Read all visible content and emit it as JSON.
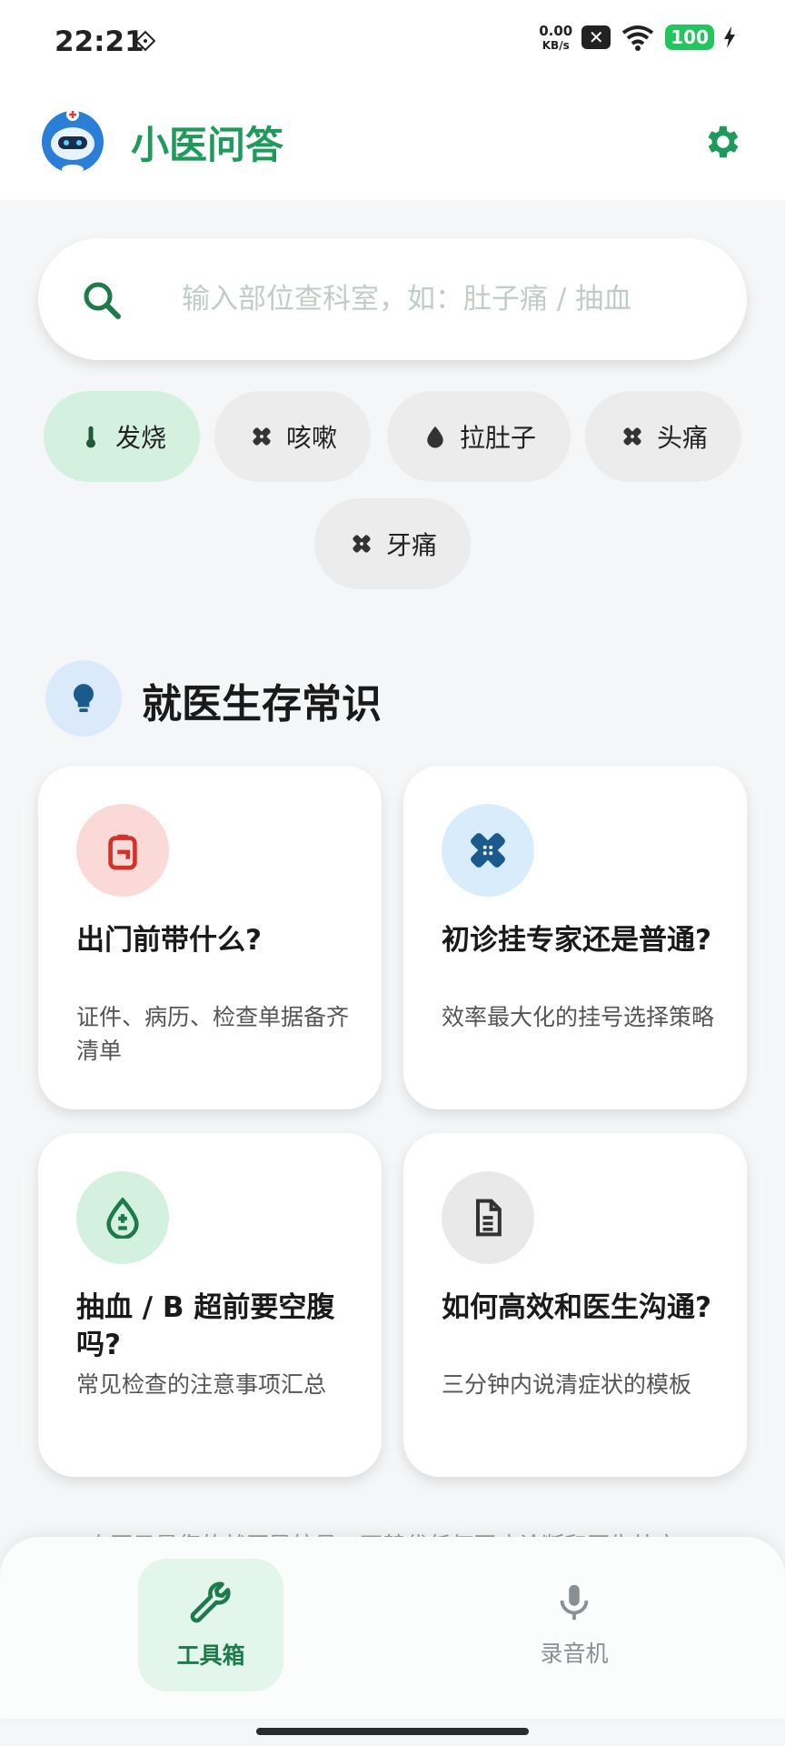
{
  "status": {
    "time": "22:21",
    "net_speed_value": "0.00",
    "net_speed_unit": "KB/s",
    "battery": "100"
  },
  "header": {
    "title": "小医问答",
    "logo_icon": "doctor-robot-avatar",
    "settings_icon": "gear-icon"
  },
  "search": {
    "placeholder": "输入部位查科室，如：肚子痛 / 抽血",
    "value": ""
  },
  "chips": [
    {
      "label": "发烧",
      "icon": "thermometer-icon",
      "active": true
    },
    {
      "label": "咳嗽",
      "icon": "bandage-icon",
      "active": false
    },
    {
      "label": "拉肚子",
      "icon": "water-drop-icon",
      "active": false
    },
    {
      "label": "头痛",
      "icon": "bandage-icon",
      "active": false
    },
    {
      "label": "牙痛",
      "icon": "bandage-icon",
      "active": false
    }
  ],
  "section": {
    "title": "就医生存常识",
    "icon": "lightbulb-icon"
  },
  "cards": [
    {
      "title": "出门前带什么?",
      "desc": "证件、病历、检查单据备齐清单",
      "icon": "backpack-icon",
      "icon_bg": "#fbd9d6",
      "icon_color": "#d0332b"
    },
    {
      "title": "初诊挂专家还是普通?",
      "desc": "效率最大化的挂号选择策略",
      "icon": "bandage-icon",
      "icon_bg": "#d9ecfb",
      "icon_color": "#1a5a8c"
    },
    {
      "title": "抽血 / B 超前要空腹吗?",
      "desc": "常见检查的注意事项汇总",
      "icon": "blood-drop-plus-minus-icon",
      "icon_bg": "#d4f1e0",
      "icon_color": "#1e7a4a"
    },
    {
      "title": "如何高效和医生沟通?",
      "desc": "三分钟内说清症状的模板",
      "icon": "document-icon",
      "icon_bg": "#e9e9e9",
      "icon_color": "#333333"
    }
  ],
  "disclaimer": "小医只是您的就医导航员，不替代任何医疗诊断和医生处方",
  "nav": {
    "items": [
      {
        "label": "工具箱",
        "icon": "wrench-icon",
        "active": true
      },
      {
        "label": "录音机",
        "icon": "microphone-icon",
        "active": false
      }
    ]
  },
  "colors": {
    "brand_green": "#1e9a5a",
    "active_chip_bg": "#d4f1e0",
    "nav_active_bg": "#e3f6ec"
  }
}
